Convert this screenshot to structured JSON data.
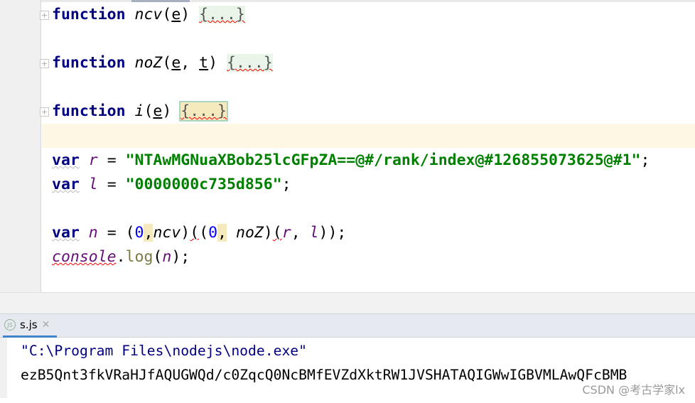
{
  "editor": {
    "fold_placeholder": "{...}",
    "fold_icon": "plus-box-icon",
    "functions": [
      {
        "keyword": "function",
        "name": "ncv",
        "params": [
          "e"
        ]
      },
      {
        "keyword": "function",
        "name": "noZ",
        "params": [
          "e",
          "t"
        ]
      },
      {
        "keyword": "function",
        "name": "i",
        "params": [
          "e"
        ]
      }
    ],
    "var_r": {
      "keyword": "var",
      "name": "r",
      "value": "\"NTAwMGNuaXBob25lcGFpZA==@#/rank/index@#126855073625@#1\""
    },
    "var_l": {
      "keyword": "var",
      "name": "l",
      "value": "\"0000000c735d856\""
    },
    "var_n": {
      "keyword": "var",
      "name": "n",
      "zero": "0",
      "f1": "ncv",
      "f2": "noZ",
      "a1": "r",
      "a2": "l"
    },
    "log": {
      "object": "console",
      "method": "log",
      "arg": "n"
    }
  },
  "run_panel": {
    "tab_label": "s.js",
    "tab_icon": "nodejs-icon",
    "command": "\"C:\\Program Files\\nodejs\\node.exe\"",
    "output": "ezB5Qnt3fkVRaHJfAQUGWQd/c0ZqcQ0NcBMfEVZdXktRW1JVSHATAQIGWwIGBVMLAwQFcBMB"
  },
  "watermark": "CSDN @考古学家lx"
}
